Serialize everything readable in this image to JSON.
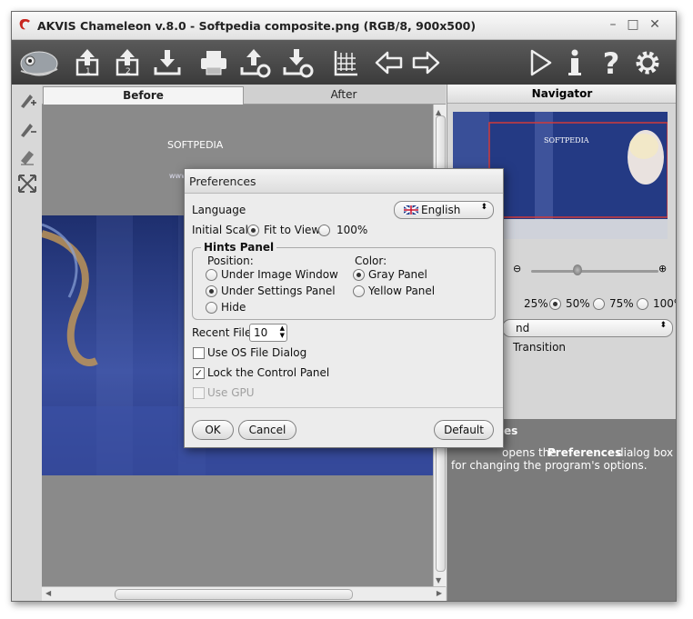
{
  "window": {
    "title": "AKVIS Chameleon v.8.0 - Softpedia composite.png (RGB/8, 900x500)",
    "minimize": "–",
    "maximize": "□",
    "close": "✕"
  },
  "toolbar": {
    "buttons": [
      "logo-chameleon",
      "open-file",
      "open-file-2",
      "save",
      "print",
      "share",
      "settings-export",
      "grid",
      "undo",
      "redo",
      "run",
      "info",
      "help",
      "preferences"
    ]
  },
  "tabs": {
    "before": "Before",
    "after": "After"
  },
  "navigator": {
    "title": "Navigator",
    "zoom_options": [
      "25%",
      "50%",
      "75%",
      "100%"
    ],
    "selected_zoom": "50%",
    "mode_value": "nd",
    "transition_label": "Transition"
  },
  "hints": {
    "title_fragment": "es",
    "text_prefix": "opens the",
    "text_bold": "Preferences",
    "text_suffix": "dialog box",
    "text_line2": "for changing the program's options."
  },
  "preferences": {
    "title": "Preferences",
    "language_label": "Language",
    "language_value": "English",
    "initial_scale_label": "Initial Scale",
    "scale_fit": "Fit to View",
    "scale_100": "100%",
    "hints_panel_label": "Hints Panel",
    "position_label": "Position:",
    "pos_under_image": "Under Image Window",
    "pos_under_settings": "Under Settings Panel",
    "pos_hide": "Hide",
    "color_label": "Color:",
    "color_gray": "Gray Panel",
    "color_yellow": "Yellow Panel",
    "recent_files_label": "Recent Files",
    "recent_files_value": "10",
    "use_os_dialog": "Use OS File Dialog",
    "lock_control_panel": "Lock the Control Panel",
    "use_gpu": "Use GPU",
    "ok": "OK",
    "cancel": "Cancel",
    "default": "Default"
  },
  "canvas": {
    "watermark": "SOFTPEDIA",
    "logo_text": "SOFTPEDIA",
    "url_text": "www.softpedia.com"
  },
  "colors": {
    "toolbar": "#474747",
    "canvas_bg": "#8a8a8a",
    "image_blue": "#2a3f8a",
    "hint_panel": "#7b7b7b"
  }
}
